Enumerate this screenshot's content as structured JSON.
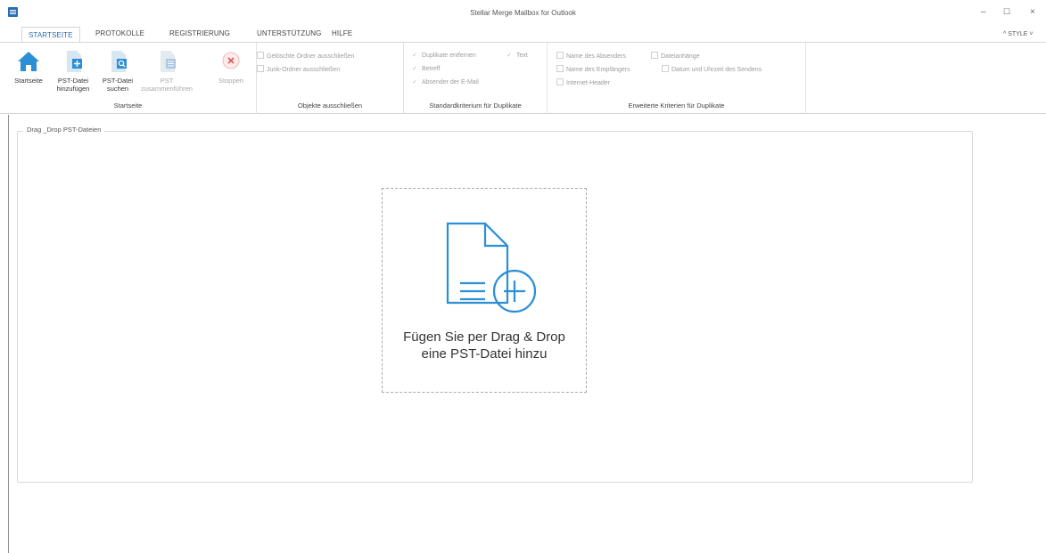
{
  "app": {
    "title": "Stellar Merge Mailbox for Outlook",
    "window_controls": {
      "minimize": "–",
      "maximize": "☐",
      "close": "×"
    }
  },
  "tabs": [
    {
      "label": "STARTSEITE",
      "active": true
    },
    {
      "label": "PROTOKOLLE",
      "active": false
    },
    {
      "label": "REGISTRIERUNG",
      "active": false
    },
    {
      "label": "UNTERSTÜTZUNG",
      "active": false
    },
    {
      "label": "HILFE",
      "active": false
    }
  ],
  "style_menu": "^ STYLE ˅",
  "ribbon": {
    "groups": {
      "startseite": {
        "label": "Startseite",
        "buttons": [
          {
            "label": "Startseite",
            "icon": "home-icon",
            "enabled": true
          },
          {
            "label": "PST-Datei hinzufügen",
            "line1": "PST-Datei",
            "line2": "hinzufügen",
            "icon": "add-file-icon",
            "enabled": true
          },
          {
            "label": "PST-Datei suchen",
            "line1": "PST-Datei",
            "line2": "suchen",
            "icon": "search-file-icon",
            "enabled": true
          },
          {
            "label": "PST zusammenführen",
            "line1": "PST",
            "line2": "zusammenführen",
            "icon": "merge-file-icon",
            "enabled": false
          },
          {
            "label": "Stoppen",
            "icon": "stop-icon",
            "enabled": false
          }
        ]
      },
      "objekte": {
        "label": "Objekte ausschließen",
        "options": [
          {
            "label": "Gelöschte Ordner ausschließen",
            "checked": false
          },
          {
            "label": "Junk-Ordner ausschließen",
            "checked": false
          }
        ]
      },
      "standard": {
        "label": "Standardkriterium für Duplikate",
        "options": [
          {
            "label": "Duplikate entfernen",
            "checked": true
          },
          {
            "label": "Text",
            "checked": true
          },
          {
            "label": "Betreff",
            "checked": true
          },
          {
            "label": "Absender der E-Mail",
            "checked": true
          }
        ]
      },
      "erweitert": {
        "label": "Erweiterte Kriterien für Duplikate",
        "options": [
          {
            "label": "Name des Absenders",
            "checked": false
          },
          {
            "label": "Dateianhänge",
            "checked": false
          },
          {
            "label": "Name des Empfängers",
            "checked": false
          },
          {
            "label": "Datum und Uhrzeit des Sendens",
            "checked": false
          },
          {
            "label": "Internet-Header",
            "checked": false
          }
        ]
      }
    }
  },
  "main": {
    "panel_title": "Drag _Drop PST-Dateien",
    "drop_line1": "Fügen Sie per Drag & Drop",
    "drop_line2": "eine PST-Datei hinzu",
    "accent_color": "#2b8fd6"
  }
}
